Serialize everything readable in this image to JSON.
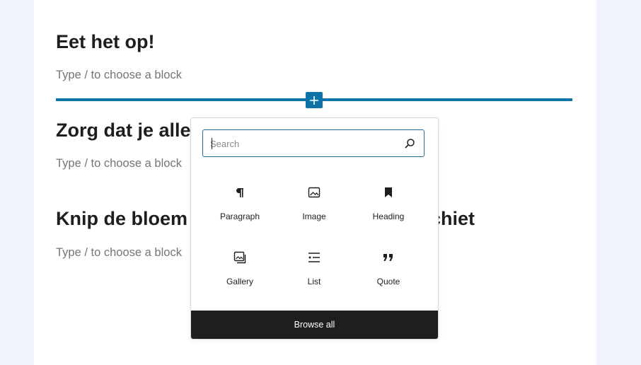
{
  "editor": {
    "blocks": [
      {
        "heading": "Eet het op!",
        "placeholder": "Type / to choose a block"
      },
      {
        "heading": "Zorg dat je alle",
        "placeholder": "Type / to choose a block"
      },
      {
        "heading": "Knip de bloem",
        "heading_tail": "chiet",
        "placeholder": "Type / to choose a block"
      }
    ],
    "accent_color": "#0e74a8"
  },
  "inserter": {
    "search": {
      "placeholder": "Search",
      "value": ""
    },
    "blocks": [
      {
        "label": "Paragraph",
        "icon": "paragraph-icon"
      },
      {
        "label": "Image",
        "icon": "image-icon"
      },
      {
        "label": "Heading",
        "icon": "heading-bookmark-icon"
      },
      {
        "label": "Gallery",
        "icon": "gallery-icon"
      },
      {
        "label": "List",
        "icon": "list-icon"
      },
      {
        "label": "Quote",
        "icon": "quote-icon"
      }
    ],
    "browse_all_label": "Browse all"
  }
}
